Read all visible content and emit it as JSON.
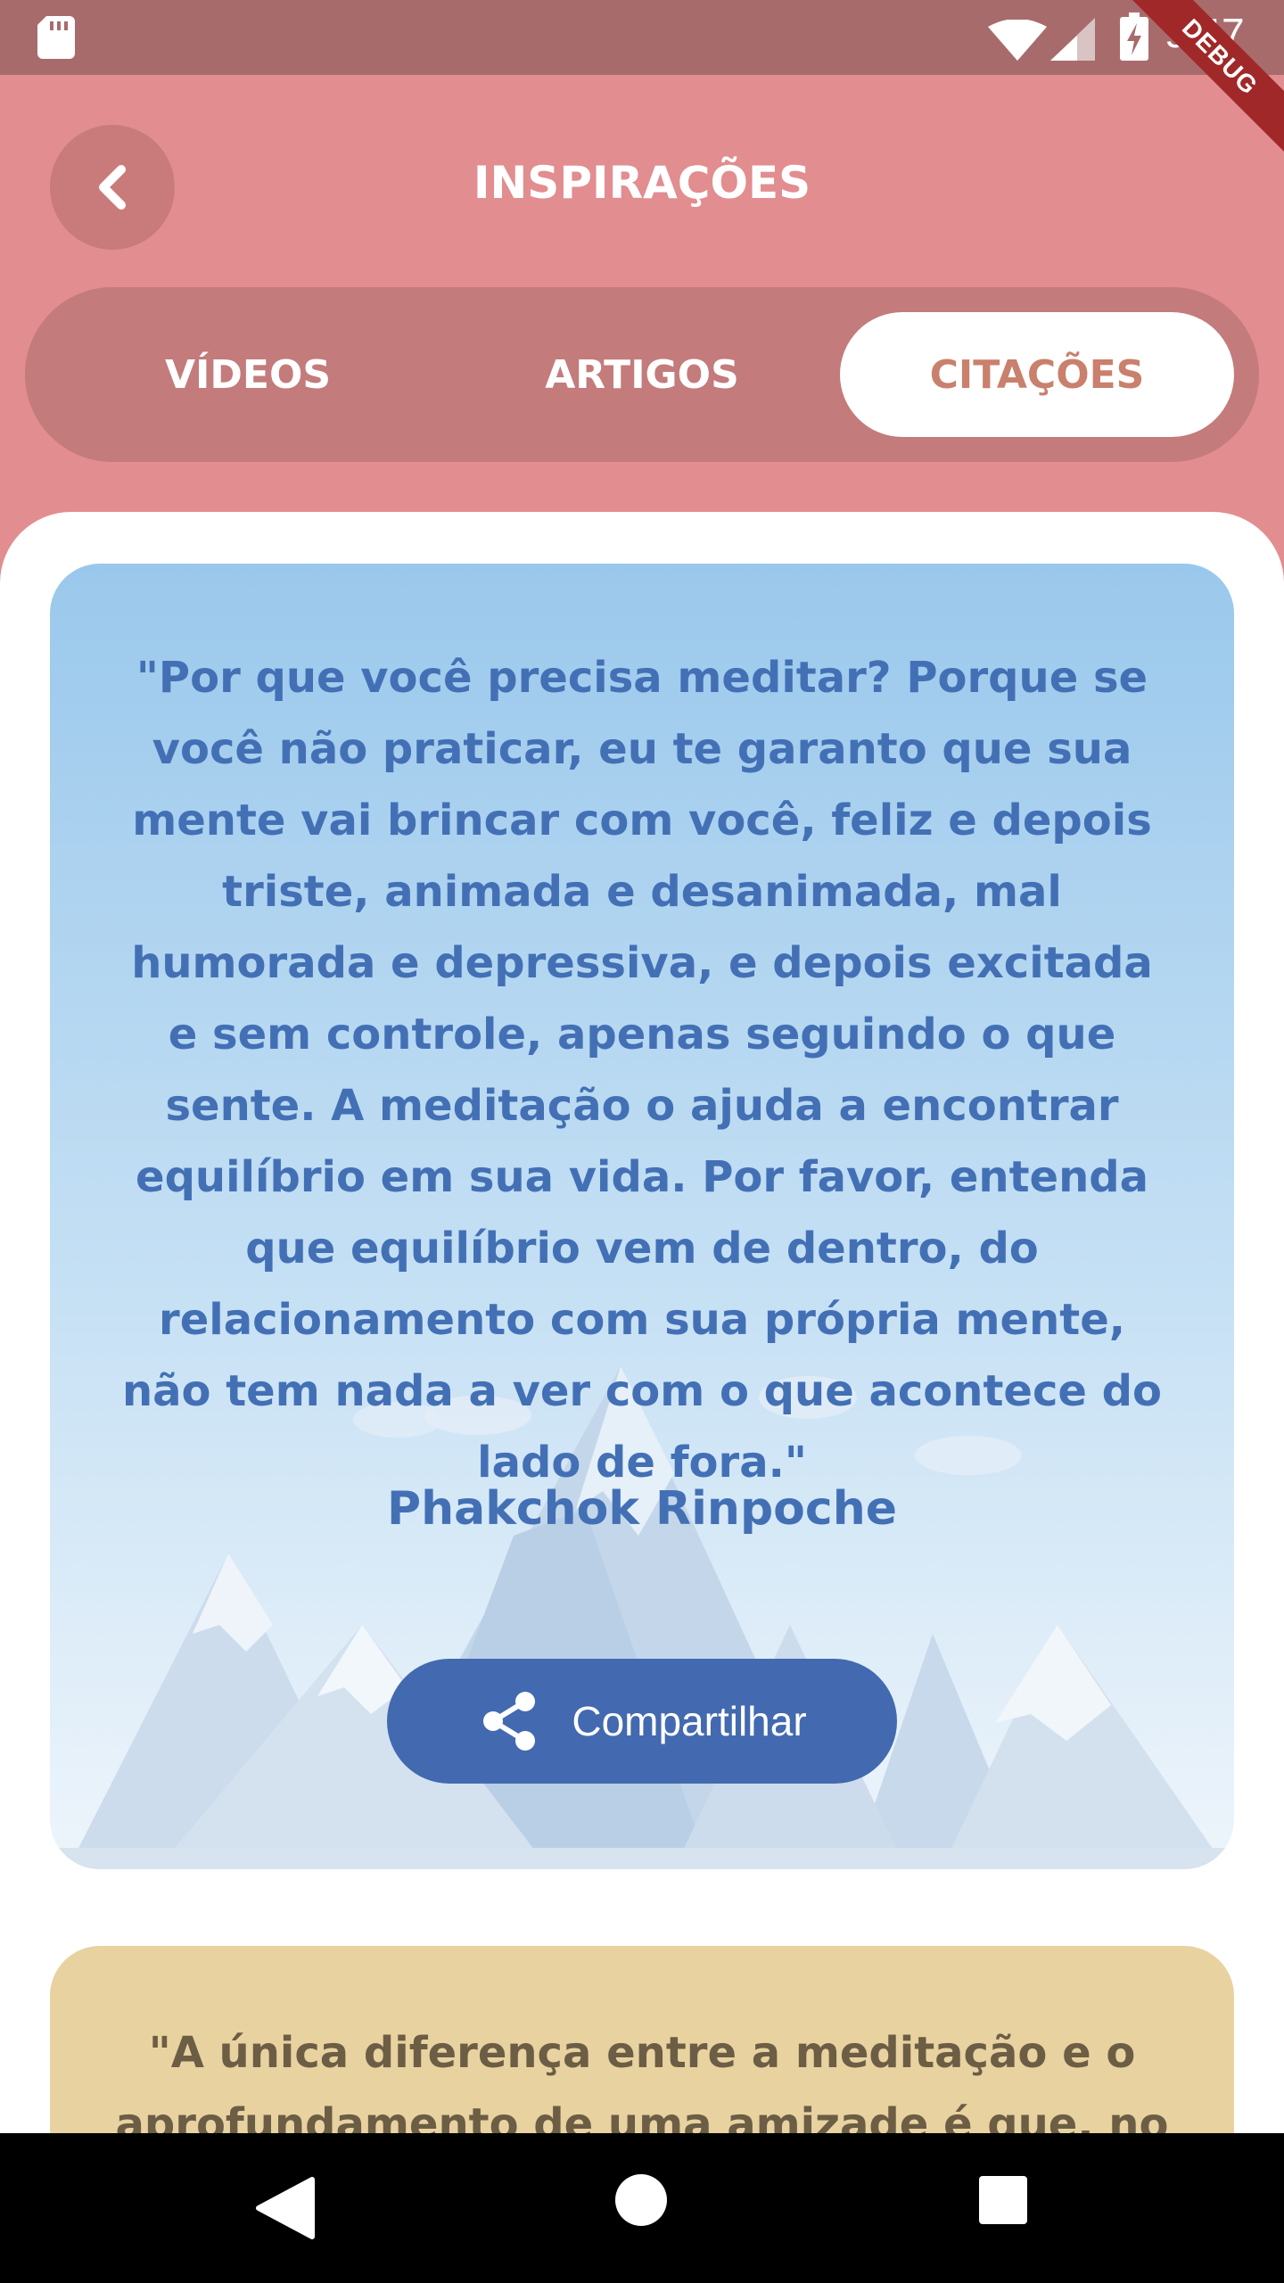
{
  "status_bar": {
    "time": "9:47",
    "debug_label": "DEBUG"
  },
  "header": {
    "title": "INSPIRAÇÕES"
  },
  "tabs": [
    {
      "label": "VÍDEOS",
      "selected": false
    },
    {
      "label": "ARTIGOS",
      "selected": false
    },
    {
      "label": "CITAÇÕES",
      "selected": true
    }
  ],
  "quotes": [
    {
      "text": "\"Por que você precisa meditar? Porque se você não praticar, eu te garanto que sua mente vai brincar com você, feliz e depois triste, animada e desanimada, mal humorada e depressiva, e depois excitada e sem controle, apenas seguindo o que sente. A meditação o ajuda a encontrar equilíbrio em sua vida. Por favor, entenda que equilíbrio vem de dentro, do relacionamento com sua própria mente, não tem nada a ver com o que acontece do lado de fora.\"",
      "author": "Phakchok Rinpoche",
      "share_label": "Compartilhar",
      "card_color": "#9ac8ec"
    },
    {
      "text": "\"A única diferença entre a meditação e o aprofundamento de uma amizade é que, no",
      "card_color": "#e8d2a0"
    }
  ],
  "colors": {
    "header_bg": "#e28d8f",
    "accent_blue": "#4370b5",
    "tab_selected_text": "#c9806c"
  },
  "icons": [
    "sd-card-icon",
    "wifi-icon",
    "signal-icon",
    "battery-icon",
    "back-chevron-icon",
    "share-icon",
    "nav-back-icon",
    "nav-home-icon",
    "nav-recent-icon"
  ]
}
